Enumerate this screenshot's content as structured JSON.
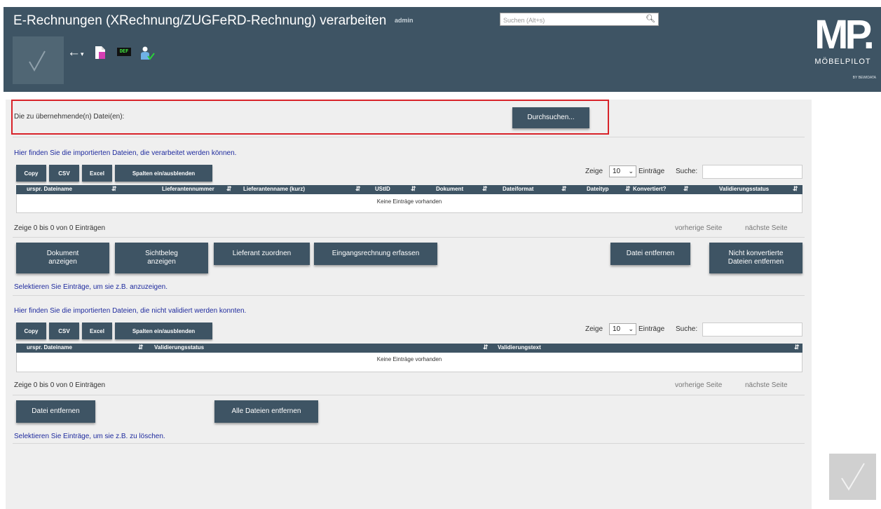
{
  "header": {
    "title": "E-Rechnungen (XRechnung/ZUGFeRD-Rechnung) verarbeiten",
    "user": "admin",
    "search_placeholder": "Suchen (Alt+s)",
    "toolbar": {
      "back_icon": "arrow-left-icon",
      "def_badge": "DEF"
    },
    "logo": {
      "mark": "MP.",
      "brand": "MÖBELPILOT",
      "by": "BY BEWIDATA"
    }
  },
  "upload": {
    "label": "Die zu übernehmende(n) Datei(en):",
    "browse_label": "Durchsuchen..."
  },
  "table1": {
    "info": "Hier finden Sie die importierten Dateien, die verarbeitet werden können.",
    "buttons": {
      "copy": "Copy",
      "csv": "CSV",
      "excel": "Excel",
      "columns": "Spalten ein/ausblenden"
    },
    "length": {
      "prefix": "Zeige",
      "value": "10",
      "suffix": "Einträge"
    },
    "search_label": "Suche:",
    "columns": [
      "urspr. Dateiname",
      "Lieferantennummer",
      "Lieferantenname (kurz)",
      "UStID",
      "Dokument",
      "Dateiformat",
      "Dateityp",
      "Konvertiert?",
      "Validierungsstatus"
    ],
    "empty": "Keine Einträge vorhanden",
    "count": "Zeige 0 bis 0 von 0 Einträgen",
    "prev": "vorherige Seite",
    "next": "nächste Seite",
    "actions": {
      "doc_line1": "Dokument",
      "doc_line2": "anzeigen",
      "sicht_line1": "Sichtbeleg",
      "sicht_line2": "anzeigen",
      "supplier": "Lieferant zuordnen",
      "invoice": "Eingangsrechnung erfassen",
      "remove": "Datei entfernen",
      "notconv_line1": "Nicht konvertierte",
      "notconv_line2": "Dateien entfernen"
    },
    "hint": "Selektieren Sie Einträge, um sie z.B. anzuzeigen."
  },
  "table2": {
    "info": "Hier finden Sie die importierten Dateien, die nicht validiert werden konnten.",
    "buttons": {
      "copy": "Copy",
      "csv": "CSV",
      "excel": "Excel",
      "columns": "Spalten ein/ausblenden"
    },
    "length": {
      "prefix": "Zeige",
      "value": "10",
      "suffix": "Einträge"
    },
    "search_label": "Suche:",
    "columns": [
      "urspr. Dateiname",
      "Validierungsstatus",
      "Validierungstext"
    ],
    "empty": "Keine Einträge vorhanden",
    "count": "Zeige 0 bis 0 von 0 Einträgen",
    "prev": "vorherige Seite",
    "next": "nächste Seite",
    "actions": {
      "remove": "Datei entfernen",
      "remove_all": "Alle Dateien entfernen"
    },
    "hint": "Selektieren Sie Einträge, um sie z.B. zu löschen."
  },
  "colors": {
    "primary": "#3e5464",
    "panel": "#efefef",
    "highlight": "#d8232a",
    "link": "#1f2b9e"
  }
}
